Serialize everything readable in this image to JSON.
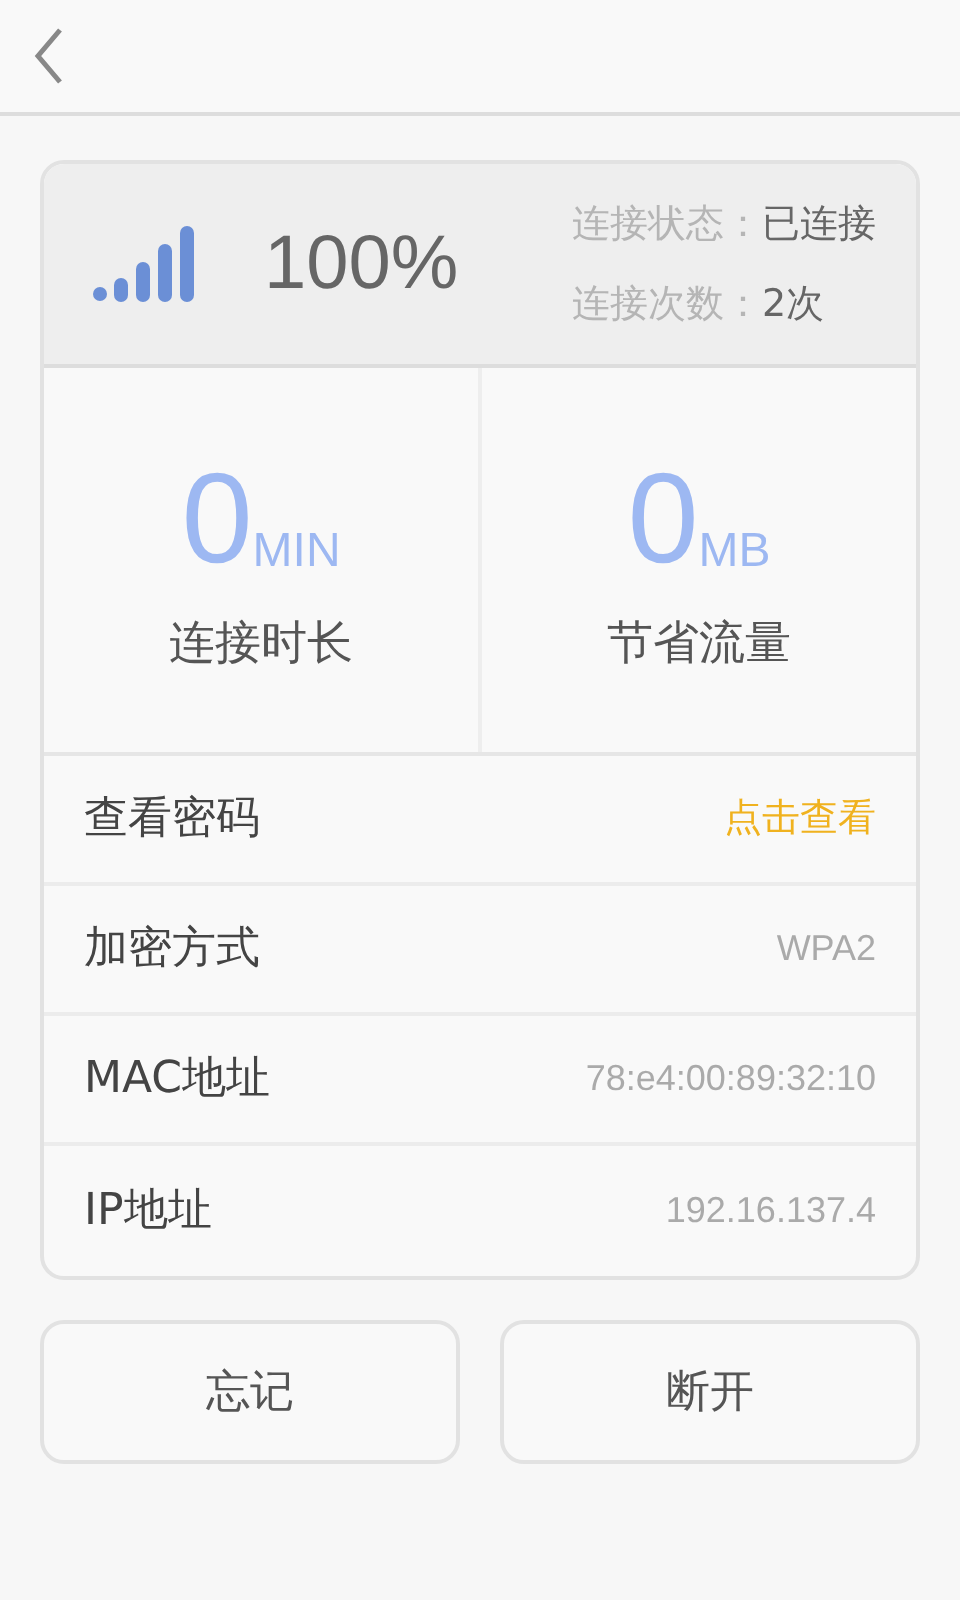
{
  "signal": {
    "percent": "100%"
  },
  "status": [
    {
      "label": "连接状态：",
      "value": "已连接"
    },
    {
      "label": "连接次数：",
      "value": "2次"
    }
  ],
  "stats": [
    {
      "value": "0",
      "unit": "MIN",
      "label": "连接时长"
    },
    {
      "value": "0",
      "unit": "MB",
      "label": "节省流量"
    }
  ],
  "rows": [
    {
      "kind": "link",
      "label": "查看密码",
      "value": "点击查看"
    },
    {
      "kind": "value",
      "label": "加密方式",
      "value": "WPA2"
    },
    {
      "kind": "value",
      "label": "MAC地址",
      "value": "78:e4:00:89:32:10"
    },
    {
      "kind": "value",
      "label": "IP地址",
      "value": "192.16.137.4"
    }
  ],
  "buttons": [
    "忘记",
    "断开"
  ]
}
